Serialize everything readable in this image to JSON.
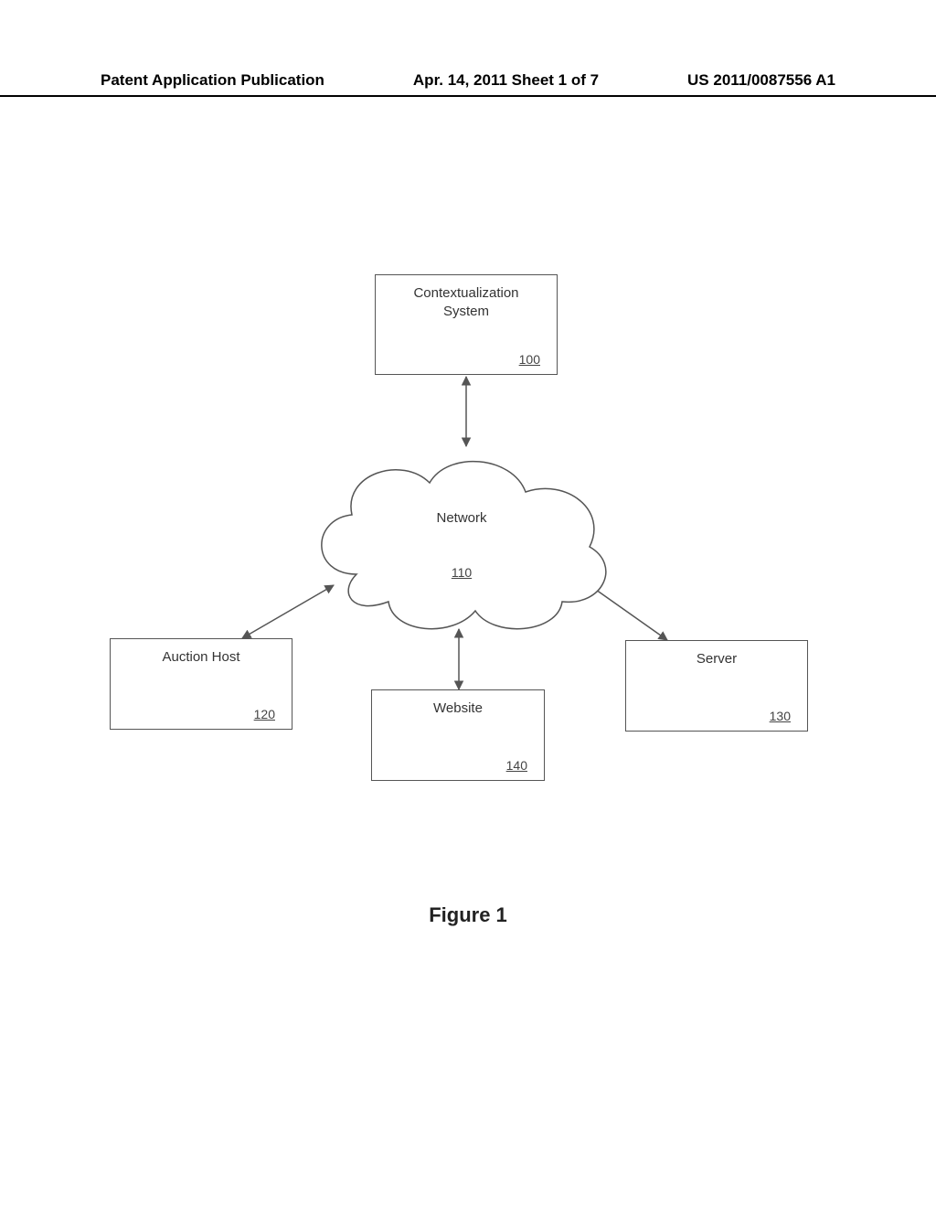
{
  "header": {
    "left": "Patent Application Publication",
    "center": "Apr. 14, 2011  Sheet 1 of 7",
    "right": "US 2011/0087556 A1"
  },
  "diagram": {
    "boxes": {
      "context": {
        "label": "Contextualization\nSystem",
        "ref": "100"
      },
      "network": {
        "label": "Network",
        "ref": "110"
      },
      "auction": {
        "label": "Auction Host",
        "ref": "120"
      },
      "server": {
        "label": "Server",
        "ref": "130"
      },
      "website": {
        "label": "Website",
        "ref": "140"
      }
    },
    "caption": "Figure 1"
  }
}
